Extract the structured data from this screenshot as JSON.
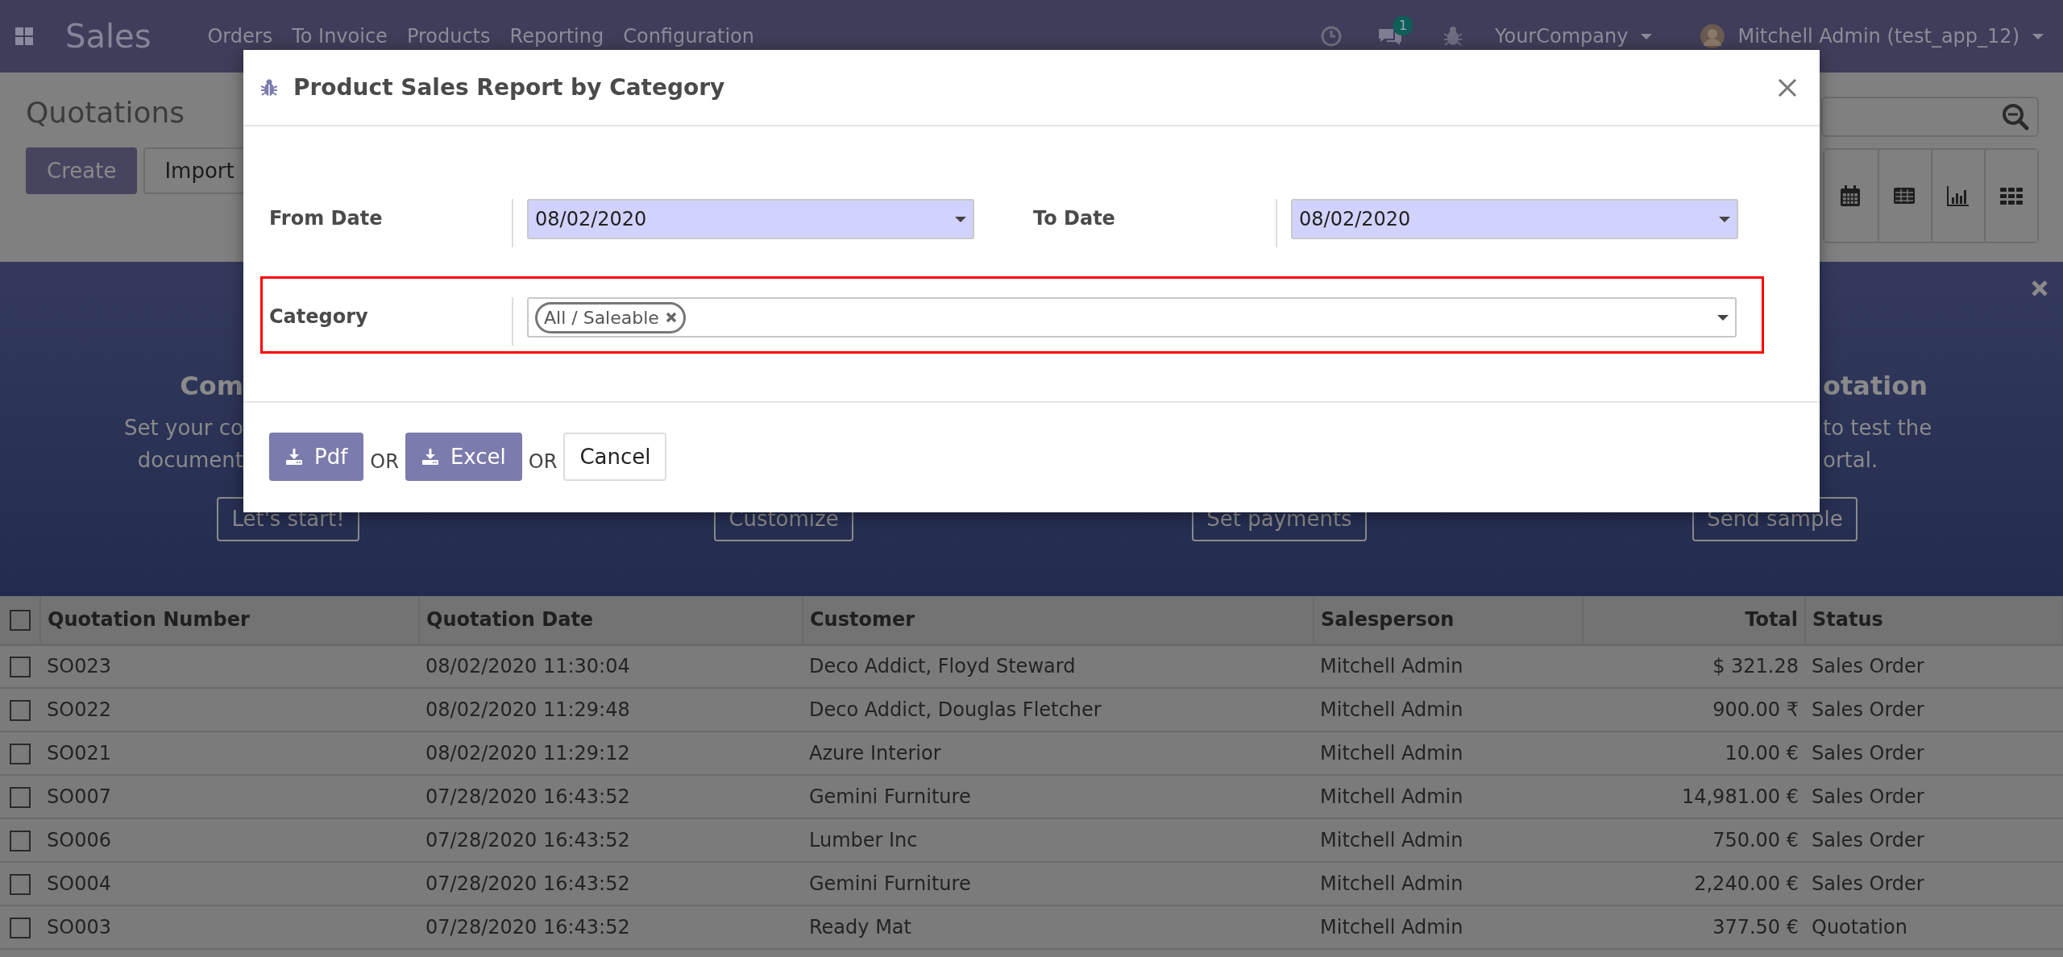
{
  "navbar": {
    "app": "Sales",
    "menu": [
      "Orders",
      "To Invoice",
      "Products",
      "Reporting",
      "Configuration"
    ],
    "chat_count": "1",
    "company": "YourCompany",
    "user": "Mitchell Admin (test_app_12)"
  },
  "control_panel": {
    "title": "Quotations",
    "buttons": [
      {
        "label": "Create",
        "kind": "primary"
      },
      {
        "label": "Import",
        "kind": "secondary"
      }
    ]
  },
  "banner": {
    "left_heading": "Com",
    "left_lines": [
      "Set your co",
      "document"
    ],
    "right_heading": "otation",
    "right_lines": [
      "to test the",
      "ortal."
    ],
    "buttons": [
      "Let's start!",
      "Customize",
      "Set payments",
      "Send sample"
    ]
  },
  "table": {
    "all_selected": false,
    "columns": [
      {
        "label": "Quotation Number",
        "kind": "text"
      },
      {
        "label": "Quotation Date",
        "kind": "text"
      },
      {
        "label": "Customer",
        "kind": "text"
      },
      {
        "label": "Salesperson",
        "kind": "text"
      },
      {
        "label": "Total",
        "kind": "monetary"
      },
      {
        "label": "Status",
        "kind": "text"
      }
    ],
    "rows": [
      {
        "selected": false,
        "cells": [
          "SO023",
          "08/02/2020 11:30:04",
          "Deco Addict, Floyd Steward",
          "Mitchell Admin",
          "$ 321.28",
          "Sales Order"
        ]
      },
      {
        "selected": false,
        "cells": [
          "SO022",
          "08/02/2020 11:29:48",
          "Deco Addict, Douglas Fletcher",
          "Mitchell Admin",
          "900.00 ₹",
          "Sales Order"
        ]
      },
      {
        "selected": false,
        "cells": [
          "SO021",
          "08/02/2020 11:29:12",
          "Azure Interior",
          "Mitchell Admin",
          "10.00 €",
          "Sales Order"
        ]
      },
      {
        "selected": false,
        "cells": [
          "SO007",
          "07/28/2020 16:43:52",
          "Gemini Furniture",
          "Mitchell Admin",
          "14,981.00 €",
          "Sales Order"
        ]
      },
      {
        "selected": false,
        "cells": [
          "SO006",
          "07/28/2020 16:43:52",
          "Lumber Inc",
          "Mitchell Admin",
          "750.00 €",
          "Sales Order"
        ]
      },
      {
        "selected": false,
        "cells": [
          "SO004",
          "07/28/2020 16:43:52",
          "Gemini Furniture",
          "Mitchell Admin",
          "2,240.00 €",
          "Sales Order"
        ]
      },
      {
        "selected": false,
        "cells": [
          "SO003",
          "07/28/2020 16:43:52",
          "Ready Mat",
          "Mitchell Admin",
          "377.50 €",
          "Quotation"
        ]
      }
    ]
  },
  "dialog": {
    "title": "Product Sales Report by Category",
    "dates": [
      {
        "label": "From Date",
        "value": "08/02/2020",
        "required": true
      },
      {
        "label": "To Date",
        "value": "08/02/2020",
        "required": true
      }
    ],
    "category": {
      "label": "Category",
      "tags": [
        "All / Saleable"
      ],
      "required": false,
      "highlighted": true
    },
    "footer": [
      {
        "kind": "download",
        "label": "Pdf"
      },
      {
        "kind": "text",
        "label": "OR"
      },
      {
        "kind": "download",
        "label": "Excel"
      },
      {
        "kind": "text",
        "label": "OR"
      },
      {
        "kind": "cancel",
        "label": "Cancel"
      }
    ]
  }
}
